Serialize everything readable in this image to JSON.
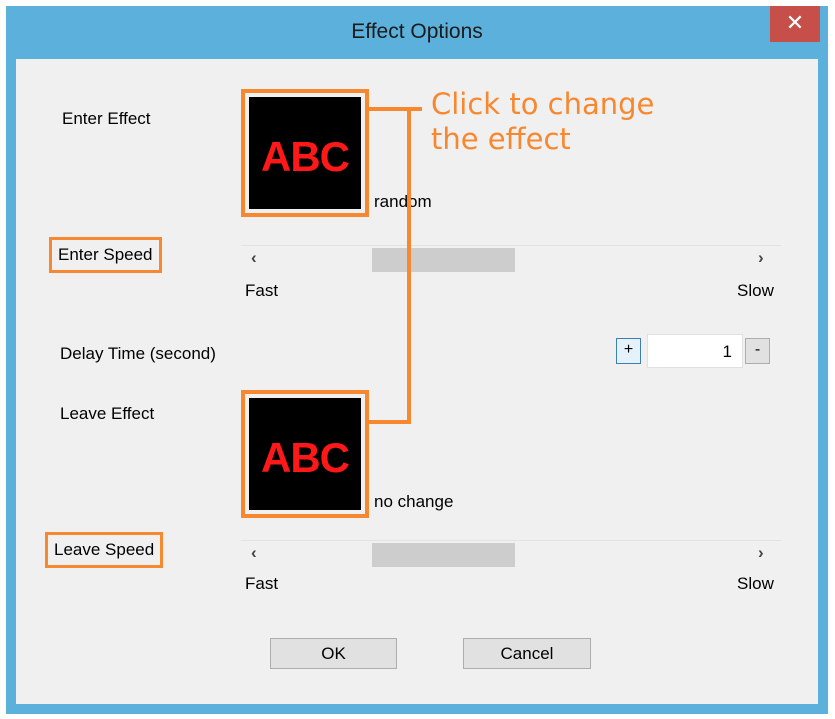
{
  "window": {
    "title": "Effect Options",
    "close_glyph": "✕"
  },
  "enter_effect": {
    "label": "Enter Effect",
    "preview_text": "ABC",
    "value": "random"
  },
  "enter_speed": {
    "label": "Enter Speed",
    "left_arrow": "‹",
    "right_arrow": "›",
    "min_label": "Fast",
    "max_label": "Slow",
    "thumb_fraction": 0.3
  },
  "delay": {
    "label": "Delay Time (second)",
    "plus_label": "+",
    "minus_label": "-",
    "value": "1"
  },
  "leave_effect": {
    "label": "Leave Effect",
    "preview_text": "ABC",
    "value": "no change"
  },
  "leave_speed": {
    "label": "Leave Speed",
    "left_arrow": "‹",
    "right_arrow": "›",
    "min_label": "Fast",
    "max_label": "Slow",
    "thumb_fraction": 0.3
  },
  "buttons": {
    "ok_label": "OK",
    "cancel_label": "Cancel"
  },
  "annotation": {
    "line1": "Click to change",
    "line2": "the effect",
    "color": "#f7882f"
  },
  "colors": {
    "titlebar": "#5bb0dc",
    "close_button": "#c74f4a",
    "dialog_background": "#f0f0f0",
    "preview_text": "#ff1818",
    "highlight": "#f7882f"
  }
}
